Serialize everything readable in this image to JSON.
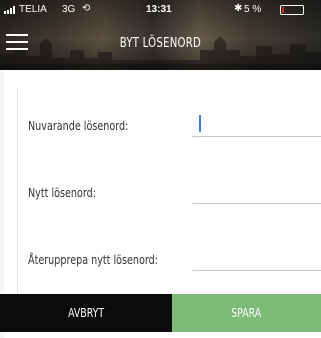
{
  "status_bar": {
    "carrier": "TELIA",
    "network": "3G",
    "activity_icon": "loading-spinner-icon",
    "time": "13:31",
    "bluetooth_icon": "bluetooth-icon",
    "battery_percent": "5 %",
    "battery_level": 0.05,
    "battery_color": "#e02020"
  },
  "header": {
    "menu_icon": "hamburger-menu-icon",
    "title": "BYT LÖSENORD"
  },
  "form": {
    "fields": [
      {
        "label": "Nuvarande lösenord:",
        "value": "",
        "focused": true
      },
      {
        "label": "Nytt lösenord:",
        "value": "",
        "focused": false
      },
      {
        "label": "Återupprepa nytt lösenord:",
        "value": "",
        "focused": false
      }
    ]
  },
  "actions": {
    "cancel_label": "AVBRYT",
    "save_label": "SPARA",
    "cancel_color": "#0b0b0b",
    "save_color": "#7dbb78"
  }
}
